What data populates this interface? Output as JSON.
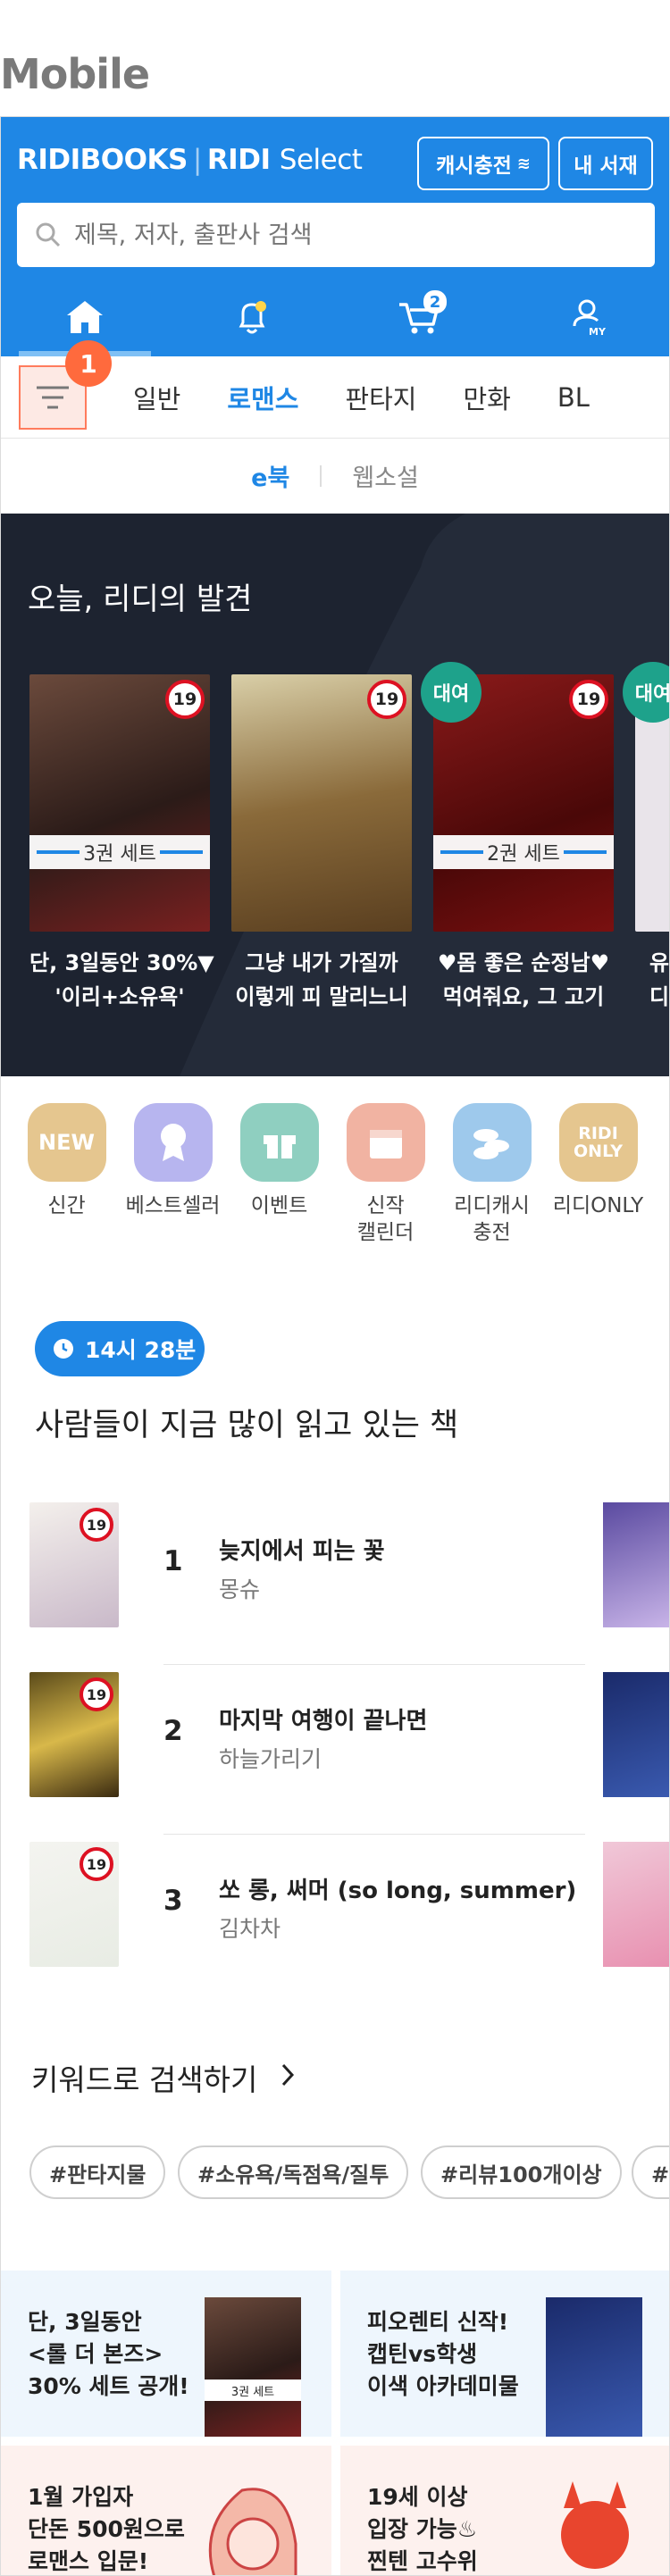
{
  "section_label": "Mobile",
  "header": {
    "logo_main": "RIDIBOOKS",
    "logo_sub_brand": "RIDI",
    "logo_sub": "Select",
    "cash_button": "캐시충전",
    "library_button": "내 서재",
    "search_placeholder": "제목, 저자, 출판사 검색",
    "cart_badge": "2",
    "profile_label": "MY"
  },
  "menu_badge": "1",
  "categories": [
    "일반",
    "로맨스",
    "판타지",
    "만화",
    "BL"
  ],
  "sub_tabs": {
    "ebook": "e북",
    "webnovel": "웹소설"
  },
  "discovery": {
    "title": "오늘, 리디의 발견",
    "age_badge": "19",
    "rent_label": "대여",
    "books": [
      {
        "set": "3권 세트",
        "line1": "단, 3일동안 30%▼",
        "line2": "'이리+소유욕'"
      },
      {
        "set": "",
        "line1": "그냥 내가 가질까",
        "line2": "이렇게 피 말리느니"
      },
      {
        "set": "2권 세트",
        "line1": "♥몸 좋은 순정남♥",
        "line2": "먹여줘요, 그 고기"
      },
      {
        "set": "",
        "line1": "유",
        "line2": "디"
      }
    ]
  },
  "quick_menu": [
    {
      "icon": "NEW",
      "label": "신간",
      "color": "#e5c68f"
    },
    {
      "icon": "",
      "label": "베스트셀러",
      "color": "#b7b5ef"
    },
    {
      "icon": "",
      "label": "이벤트",
      "color": "#8fcfc0"
    },
    {
      "icon": "",
      "label": "신작\n캘린더",
      "color": "#f1b3a2"
    },
    {
      "icon": "",
      "label": "리디캐시\n충전",
      "color": "#9ec9ec"
    },
    {
      "icon": "RIDI ONLY",
      "label": "리디ONLY",
      "color": "#e5c68f"
    }
  ],
  "trending": {
    "time": "14시 28분",
    "title": "사람들이 지금 많이 읽고 있는 책",
    "books": [
      {
        "rank": "1",
        "title": "늦지에서 피는 꽃",
        "author": "몽슈"
      },
      {
        "rank": "2",
        "title": "마지막 여행이 끝나면",
        "author": "하늘가리기"
      },
      {
        "rank": "3",
        "title": "쏘 롱, 써머 (so long, summer)",
        "author": "김차차"
      }
    ]
  },
  "keywords": {
    "title": "키워드로 검색하기",
    "chips": [
      "#판타지물",
      "#소유욕/독점욕/질투",
      "#리뷰100개이상",
      "#킹"
    ]
  },
  "banners": [
    {
      "text": "단, 3일동안\n<롤 더 본즈>\n30% 세트 공개!",
      "badge": "3권 세트"
    },
    {
      "text": "피오렌티 신작!\n캡틴vs학생\n이색 아카데미물"
    },
    {
      "text": "1월 가입자\n단돈 500원으로\n로맨스 입문!"
    },
    {
      "text": "19세 이상\n입장 가능♨\n찐텐 고수위"
    }
  ]
}
